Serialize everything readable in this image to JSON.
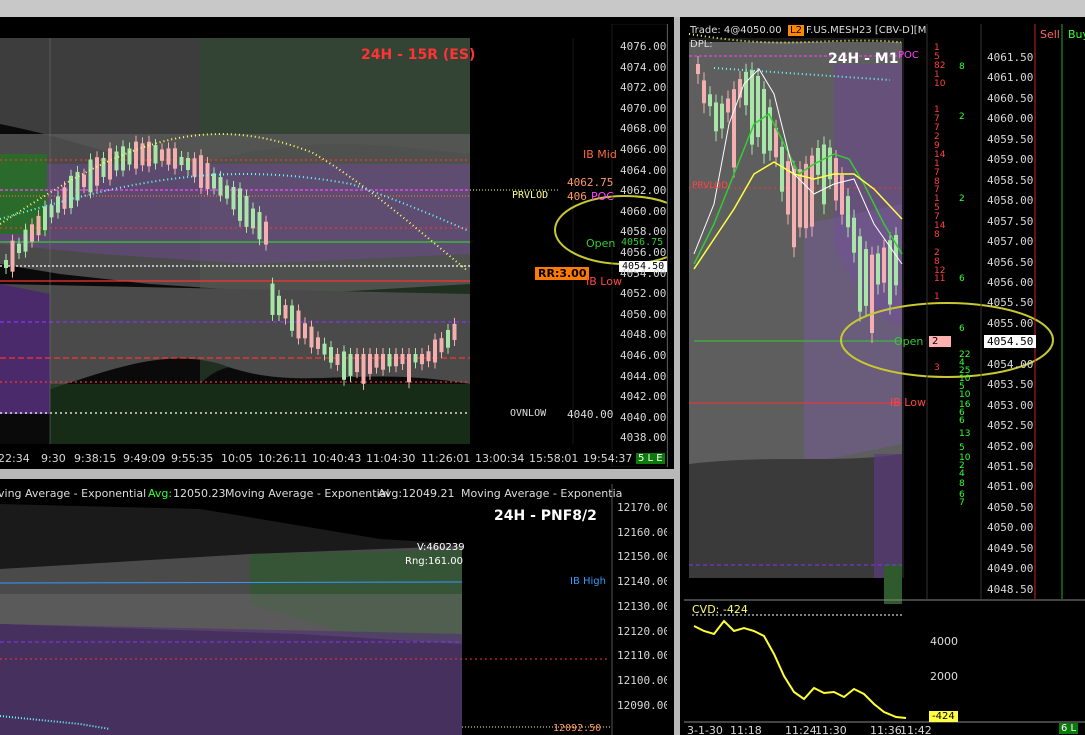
{
  "colors": {
    "up": "#a8e6a8",
    "down": "#f4b0b0",
    "poc": "#ff44ff",
    "red": "#ff3030",
    "yellow": "#ffff66",
    "cyan": "#66ffff",
    "green": "#33cc33",
    "orange": "#ff6a00"
  },
  "chart1": {
    "title": "24H - 15R (ES)",
    "price_ticks": [
      "4076.00",
      "4074.00",
      "4072.00",
      "4070.00",
      "4068.00",
      "4066.00",
      "4064.00",
      "4062.00",
      "4060.00",
      "4058.00",
      "4056.00",
      "4054.00",
      "4052.00",
      "4050.00",
      "4048.00",
      "4046.00",
      "4044.00",
      "4042.00",
      "4040.00",
      "4038.00"
    ],
    "time_ticks": [
      "22:34",
      "9:30",
      "9:38:15",
      "9:49:09",
      "9:55:35",
      "10:05",
      "10:26:11",
      "10:40:43",
      "11:04:30",
      "11:26:01",
      "13:00:34",
      "15:58:01",
      "19:54:37"
    ],
    "status": "5 L E",
    "labels": {
      "ib_mid": "IB Mid",
      "prv_val": "4062.75",
      "prvlod": "PRVLOD",
      "poc_val": "406",
      "poc": "POC",
      "open": "Open",
      "open_val": "4056.75",
      "last": "4054.50",
      "rr": "RR:3.00",
      "ib_low": "IB Low",
      "ovnlow": "OVNLOW",
      "ovnlow_val": "4040.00"
    }
  },
  "chart2": {
    "ma1_label": "ving Average - Exponential",
    "ma1_avg_label": "Avg:",
    "ma1_avg": "12050.23",
    "ma2_label": "Moving Average - Exponential",
    "ma2_avg_label": "Avg:",
    "ma2_avg": "12049.21",
    "ma3_label": "Moving Average - Exponentia",
    "title": "24H - PNF8/2",
    "volume": "V:460239",
    "range": "Rng:161.00",
    "ib_high": "IB High",
    "price_ticks": [
      "12170.00",
      "12160.00",
      "12150.00",
      "12140.00",
      "12130.00",
      "12120.00",
      "12110.00",
      "12100.00",
      "12090.00"
    ],
    "last": "12092.50"
  },
  "chart3": {
    "header_trade": "Trade: 4@4050.00",
    "l2": "L2",
    "symbol": "F.US.MESH23 [CBV-D][M",
    "dpl": "DPL:",
    "title": "24H - M1",
    "price_ticks": [
      "4061.50",
      "4061.00",
      "4060.50",
      "4060.00",
      "4059.50",
      "4059.00",
      "4058.50",
      "4058.00",
      "4057.50",
      "4057.00",
      "4056.50",
      "4056.00",
      "4055.50",
      "4055.00",
      "4054.50",
      "4054.00",
      "4053.50",
      "4053.00",
      "4052.50",
      "4052.00",
      "4051.50",
      "4051.00",
      "4050.50",
      "4050.00",
      "4049.50",
      "4049.00",
      "4048.50"
    ],
    "last": "4054.50",
    "open": "Open",
    "ib_low": "IB Low",
    "poc": "POC",
    "prv_lo": "PRVLOD",
    "sell_col": "Sell",
    "buy_col": "Buy",
    "sell_vals": [
      "1",
      "5",
      "82",
      "1",
      "10",
      "",
      "",
      "1",
      "7",
      "7",
      "2",
      "9",
      "14",
      "1",
      "7",
      "8",
      "7",
      "1",
      "5",
      "7",
      "14",
      "8",
      "",
      "2",
      "8",
      "12",
      "11",
      "",
      "1",
      "",
      "",
      "",
      "",
      "",
      "",
      "",
      "3"
    ],
    "buy_vals": [
      "8",
      "2",
      "",
      "2",
      "",
      "6",
      "6",
      "22",
      "4",
      "25",
      "10",
      "5",
      "10",
      "16",
      "6",
      "6",
      "13",
      "5",
      "10",
      "2",
      "4",
      "8",
      "6",
      "7"
    ],
    "cur_sell": "2",
    "cvd_label": "CVD: -424",
    "cvd_ticks": [
      "4000",
      "2000"
    ],
    "cvd_last": "-424",
    "time_ticks": [
      "3-1-30",
      "11:18",
      "11:24",
      "11:30",
      "11:36",
      "11:42"
    ],
    "status": "6 L"
  }
}
